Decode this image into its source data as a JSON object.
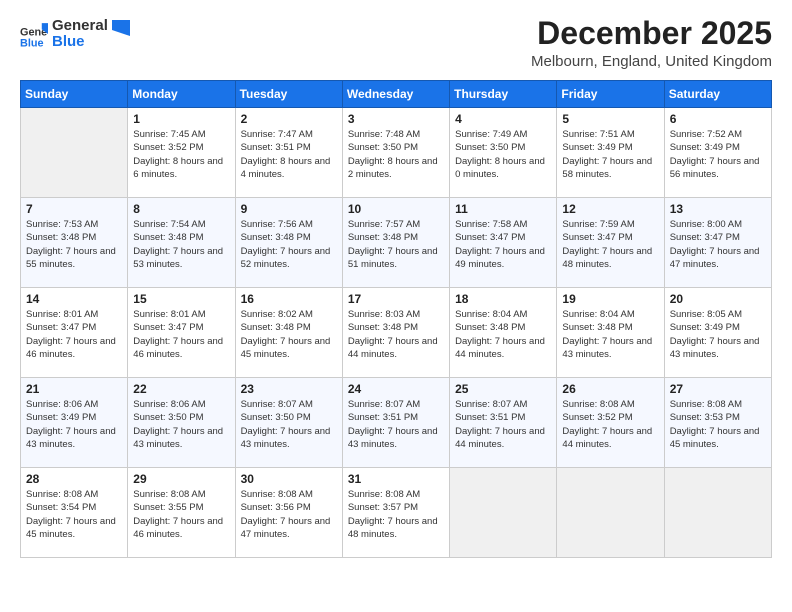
{
  "header": {
    "logo_general": "General",
    "logo_blue": "Blue",
    "month_title": "December 2025",
    "location": "Melbourn, England, United Kingdom"
  },
  "days_of_week": [
    "Sunday",
    "Monday",
    "Tuesday",
    "Wednesday",
    "Thursday",
    "Friday",
    "Saturday"
  ],
  "weeks": [
    [
      {
        "num": "",
        "empty": true
      },
      {
        "num": "1",
        "sunrise": "7:45 AM",
        "sunset": "3:52 PM",
        "daylight": "8 hours and 6 minutes."
      },
      {
        "num": "2",
        "sunrise": "7:47 AM",
        "sunset": "3:51 PM",
        "daylight": "8 hours and 4 minutes."
      },
      {
        "num": "3",
        "sunrise": "7:48 AM",
        "sunset": "3:50 PM",
        "daylight": "8 hours and 2 minutes."
      },
      {
        "num": "4",
        "sunrise": "7:49 AM",
        "sunset": "3:50 PM",
        "daylight": "8 hours and 0 minutes."
      },
      {
        "num": "5",
        "sunrise": "7:51 AM",
        "sunset": "3:49 PM",
        "daylight": "7 hours and 58 minutes."
      },
      {
        "num": "6",
        "sunrise": "7:52 AM",
        "sunset": "3:49 PM",
        "daylight": "7 hours and 56 minutes."
      }
    ],
    [
      {
        "num": "7",
        "sunrise": "7:53 AM",
        "sunset": "3:48 PM",
        "daylight": "7 hours and 55 minutes."
      },
      {
        "num": "8",
        "sunrise": "7:54 AM",
        "sunset": "3:48 PM",
        "daylight": "7 hours and 53 minutes."
      },
      {
        "num": "9",
        "sunrise": "7:56 AM",
        "sunset": "3:48 PM",
        "daylight": "7 hours and 52 minutes."
      },
      {
        "num": "10",
        "sunrise": "7:57 AM",
        "sunset": "3:48 PM",
        "daylight": "7 hours and 51 minutes."
      },
      {
        "num": "11",
        "sunrise": "7:58 AM",
        "sunset": "3:47 PM",
        "daylight": "7 hours and 49 minutes."
      },
      {
        "num": "12",
        "sunrise": "7:59 AM",
        "sunset": "3:47 PM",
        "daylight": "7 hours and 48 minutes."
      },
      {
        "num": "13",
        "sunrise": "8:00 AM",
        "sunset": "3:47 PM",
        "daylight": "7 hours and 47 minutes."
      }
    ],
    [
      {
        "num": "14",
        "sunrise": "8:01 AM",
        "sunset": "3:47 PM",
        "daylight": "7 hours and 46 minutes."
      },
      {
        "num": "15",
        "sunrise": "8:01 AM",
        "sunset": "3:47 PM",
        "daylight": "7 hours and 46 minutes."
      },
      {
        "num": "16",
        "sunrise": "8:02 AM",
        "sunset": "3:48 PM",
        "daylight": "7 hours and 45 minutes."
      },
      {
        "num": "17",
        "sunrise": "8:03 AM",
        "sunset": "3:48 PM",
        "daylight": "7 hours and 44 minutes."
      },
      {
        "num": "18",
        "sunrise": "8:04 AM",
        "sunset": "3:48 PM",
        "daylight": "7 hours and 44 minutes."
      },
      {
        "num": "19",
        "sunrise": "8:04 AM",
        "sunset": "3:48 PM",
        "daylight": "7 hours and 43 minutes."
      },
      {
        "num": "20",
        "sunrise": "8:05 AM",
        "sunset": "3:49 PM",
        "daylight": "7 hours and 43 minutes."
      }
    ],
    [
      {
        "num": "21",
        "sunrise": "8:06 AM",
        "sunset": "3:49 PM",
        "daylight": "7 hours and 43 minutes."
      },
      {
        "num": "22",
        "sunrise": "8:06 AM",
        "sunset": "3:50 PM",
        "daylight": "7 hours and 43 minutes."
      },
      {
        "num": "23",
        "sunrise": "8:07 AM",
        "sunset": "3:50 PM",
        "daylight": "7 hours and 43 minutes."
      },
      {
        "num": "24",
        "sunrise": "8:07 AM",
        "sunset": "3:51 PM",
        "daylight": "7 hours and 43 minutes."
      },
      {
        "num": "25",
        "sunrise": "8:07 AM",
        "sunset": "3:51 PM",
        "daylight": "7 hours and 44 minutes."
      },
      {
        "num": "26",
        "sunrise": "8:08 AM",
        "sunset": "3:52 PM",
        "daylight": "7 hours and 44 minutes."
      },
      {
        "num": "27",
        "sunrise": "8:08 AM",
        "sunset": "3:53 PM",
        "daylight": "7 hours and 45 minutes."
      }
    ],
    [
      {
        "num": "28",
        "sunrise": "8:08 AM",
        "sunset": "3:54 PM",
        "daylight": "7 hours and 45 minutes."
      },
      {
        "num": "29",
        "sunrise": "8:08 AM",
        "sunset": "3:55 PM",
        "daylight": "7 hours and 46 minutes."
      },
      {
        "num": "30",
        "sunrise": "8:08 AM",
        "sunset": "3:56 PM",
        "daylight": "7 hours and 47 minutes."
      },
      {
        "num": "31",
        "sunrise": "8:08 AM",
        "sunset": "3:57 PM",
        "daylight": "7 hours and 48 minutes."
      },
      {
        "num": "",
        "empty": true
      },
      {
        "num": "",
        "empty": true
      },
      {
        "num": "",
        "empty": true
      }
    ]
  ],
  "labels": {
    "sunrise_prefix": "Sunrise: ",
    "sunset_prefix": "Sunset: ",
    "daylight_prefix": "Daylight: "
  }
}
